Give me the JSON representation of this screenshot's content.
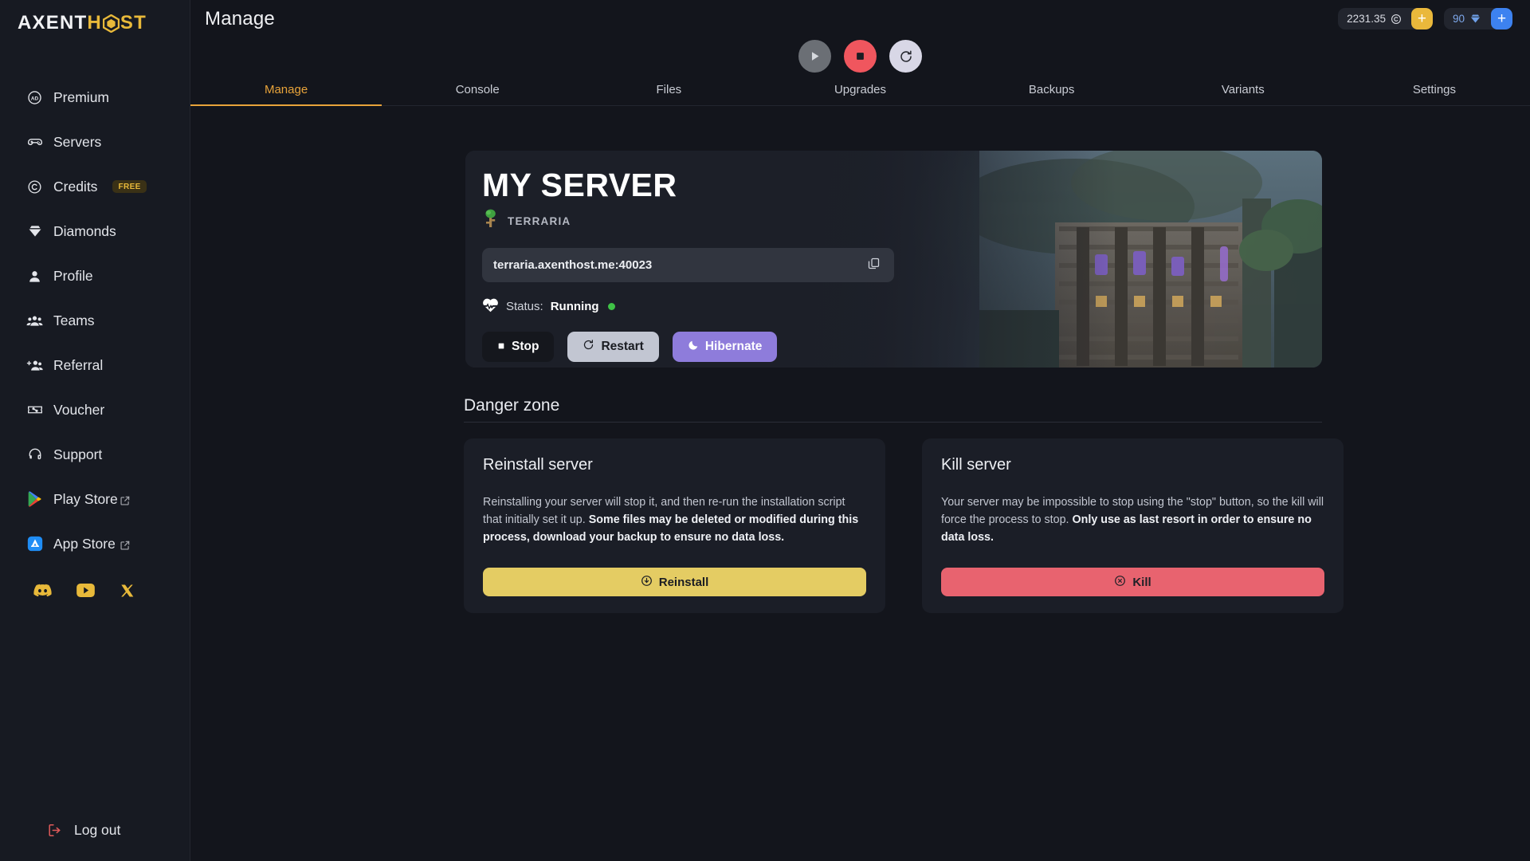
{
  "brand": {
    "name_white": "AXENT",
    "name_gold_pre": "H",
    "name_gold_post": "ST",
    "full": "AXENTHOST"
  },
  "sidebar": {
    "items": [
      {
        "label": "Premium",
        "icon": "ad-badge-icon",
        "badge": ""
      },
      {
        "label": "Servers",
        "icon": "gamepad-icon",
        "badge": ""
      },
      {
        "label": "Credits",
        "icon": "credit-coin-icon",
        "badge": "FREE"
      },
      {
        "label": "Diamonds",
        "icon": "diamond-icon",
        "badge": ""
      },
      {
        "label": "Profile",
        "icon": "user-icon",
        "badge": ""
      },
      {
        "label": "Teams",
        "icon": "users-group-icon",
        "badge": ""
      },
      {
        "label": "Referral",
        "icon": "user-plus-icon",
        "badge": ""
      },
      {
        "label": "Voucher",
        "icon": "ticket-percent-icon",
        "badge": ""
      },
      {
        "label": "Support",
        "icon": "headset-icon",
        "badge": ""
      }
    ],
    "store_links": [
      {
        "label": "Play Store",
        "icon": "google-play-icon",
        "external": "external-link-icon"
      },
      {
        "label": "App Store",
        "icon": "app-store-icon",
        "external": "external-link-icon"
      }
    ],
    "socials": [
      {
        "name": "discord-icon"
      },
      {
        "name": "youtube-icon"
      },
      {
        "name": "x-twitter-icon"
      }
    ],
    "logout": {
      "label": "Log out",
      "icon": "logout-icon"
    }
  },
  "header": {
    "title": "Manage",
    "wallets": [
      {
        "value": "2231.35",
        "icon": "credit-coin-icon",
        "plus": "+",
        "accent": "#eab83b"
      },
      {
        "value": "90",
        "icon": "diamond-icon",
        "plus": "+",
        "accent": "#3d82f0"
      }
    ]
  },
  "power_buttons": [
    {
      "name": "start-button",
      "icon": "play-icon",
      "color": "#6b6f75",
      "state": "disabled"
    },
    {
      "name": "stop-button",
      "icon": "stop-icon",
      "color": "#f0565e",
      "state": "enabled"
    },
    {
      "name": "restart-button",
      "icon": "restart-icon",
      "color": "#d8d7e6",
      "state": "enabled"
    }
  ],
  "tabs": [
    {
      "label": "Manage",
      "active": true
    },
    {
      "label": "Console",
      "active": false
    },
    {
      "label": "Files",
      "active": false
    },
    {
      "label": "Upgrades",
      "active": false
    },
    {
      "label": "Backups",
      "active": false
    },
    {
      "label": "Variants",
      "active": false
    },
    {
      "label": "Settings",
      "active": false
    }
  ],
  "server": {
    "name": "MY SERVER",
    "game": "TERRARIA",
    "game_icon": "terraria-tree-icon",
    "address": "terraria.axenthost.me:40023",
    "copy_icon": "copy-icon",
    "status_label": "Status:",
    "status_value": "Running",
    "status_color": "#3fc246",
    "status_icon": "heartbeat-icon",
    "actions": [
      {
        "label": "Stop",
        "icon": "stop-square-icon",
        "style": "dark"
      },
      {
        "label": "Restart",
        "icon": "restart-icon",
        "style": "light"
      },
      {
        "label": "Hibernate",
        "icon": "moon-icon",
        "style": "purple"
      }
    ]
  },
  "danger_zone": {
    "heading": "Danger zone",
    "cards": [
      {
        "title": "Reinstall server",
        "body_normal_1": "Reinstalling your server will stop it, and then re-run the installation script that initially set it up. ",
        "body_bold": "Some files may be deleted or modified during this process, download your backup to ensure no data loss.",
        "body_normal_2": "",
        "button_label": "Reinstall",
        "button_icon": "download-circle-icon",
        "button_color": "#e4cc63"
      },
      {
        "title": "Kill server",
        "body_normal_1": "Your server may be impossible to stop using the \"stop\" button, so the kill will force the process to stop. ",
        "body_bold": "Only use as last resort in order to ensure no data loss.",
        "body_normal_2": "",
        "button_label": "Kill",
        "button_icon": "x-circle-icon",
        "button_color": "#e8636f"
      }
    ]
  }
}
